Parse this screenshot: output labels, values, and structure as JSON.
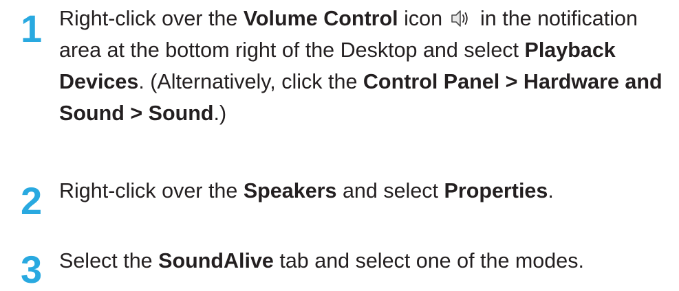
{
  "steps": [
    {
      "number": "1",
      "t1": "Right-click over the ",
      "b1": "Volume Control",
      "t2": " icon ",
      "icon": "speaker-volume-icon",
      "t3": " in the notification area at the bottom right of the Desktop and select ",
      "b2": "Playback Devices",
      "t4": ". (Alternatively, click the ",
      "b3": "Control Panel > Hardware and Sound > Sound",
      "t5": ".)"
    },
    {
      "number": "2",
      "t1": "Right-click over the ",
      "b1": "Speakers",
      "t2": " and select ",
      "b2": "Properties",
      "t3": "."
    },
    {
      "number": "3",
      "t1": "Select the ",
      "b1": "SoundAlive",
      "t2": " tab and select one of the modes."
    }
  ],
  "colors": {
    "step_number": "#29a9e0",
    "text": "#231f20"
  }
}
